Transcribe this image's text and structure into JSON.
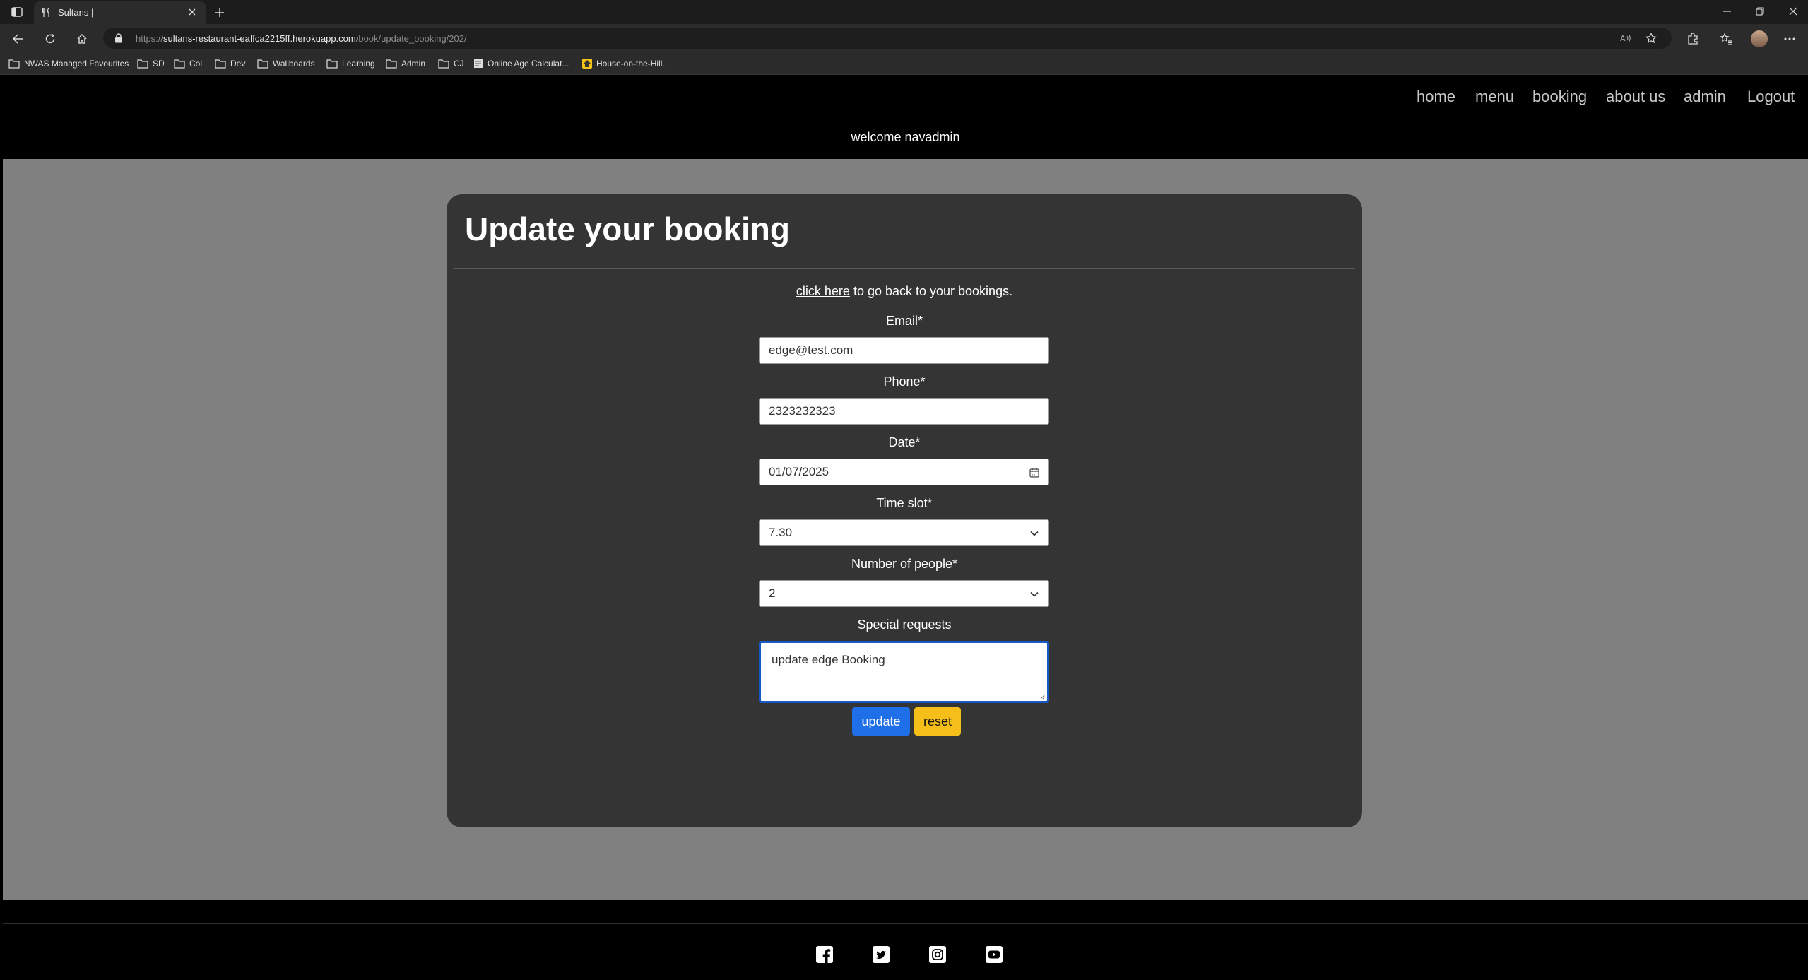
{
  "browser": {
    "tab_title": "Sultans |",
    "url_scheme": "https://",
    "url_host": "sultans-restaurant-eaffca2215ff.herokuapp.com",
    "url_path": "/book/update_booking/202/",
    "favorites": [
      "NWAS Managed Favourites",
      "SD",
      "Col.",
      "Dev",
      "Wallboards",
      "Learning",
      "Admin",
      "CJ",
      "Online Age Calculat...",
      "House-on-the-Hill..."
    ]
  },
  "site": {
    "nav": [
      "home",
      "menu",
      "booking",
      "about us",
      "admin",
      "Logout"
    ],
    "welcome": "welcome navadmin"
  },
  "form": {
    "title": "Update your booking",
    "back_link": "click here",
    "back_text": " to go back to your bookings.",
    "email_label": "Email*",
    "email_value": "edge@test.com",
    "phone_label": "Phone*",
    "phone_value": "2323232323",
    "date_label": "Date*",
    "date_value": "01/07/2025",
    "time_label": "Time slot*",
    "time_value": "7.30",
    "people_label": "Number of people*",
    "people_value": "2",
    "requests_label": "Special requests",
    "requests_value": "update edge Booking",
    "update_label": "update",
    "reset_label": "reset"
  },
  "footer": {
    "social_icons": [
      "facebook-icon",
      "twitter-icon",
      "instagram-icon",
      "youtube-icon"
    ]
  }
}
